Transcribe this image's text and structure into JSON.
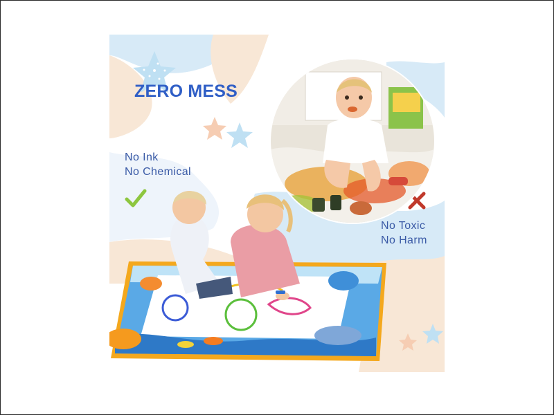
{
  "headline": "ZERO MESS",
  "left_claims": [
    "No Ink",
    "No Chemical"
  ],
  "right_claims": [
    "No Toxic",
    "No Harm"
  ],
  "icons": {
    "check": "check-icon",
    "cross": "cross-icon",
    "starfish": "starfish-icon"
  },
  "colors": {
    "headline": "#2f5ec6",
    "claim_text": "#3a5aa6",
    "check": "#8dc63f",
    "cross": "#c0392b",
    "background_blue": "#d7eaf7",
    "background_beige": "#f8e7d6"
  }
}
